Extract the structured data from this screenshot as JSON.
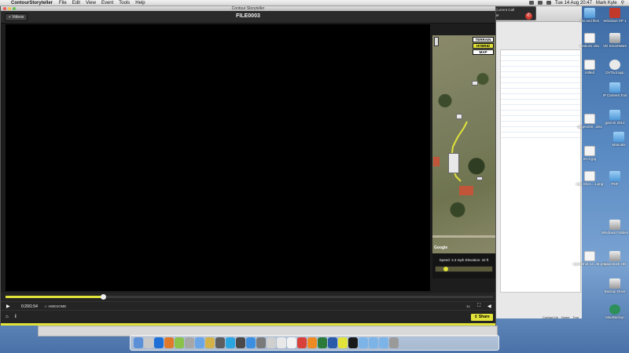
{
  "menubar": {
    "app_name": "ContourStoryteller",
    "menus": [
      "File",
      "Edit",
      "View",
      "Event",
      "Tools",
      "Help"
    ],
    "clock": "Tue 14 Aug 20:47",
    "user": "Mark Kyle"
  },
  "call_window": {
    "title": "Current Call",
    "caller": "elsyhller"
  },
  "app_window": {
    "title": "Contour Storyteller",
    "back_button": "« Videos",
    "file_title": "FILE0003",
    "map": {
      "types": [
        "TERRAIN",
        "HYBRID",
        "MAP"
      ],
      "selected_type": "HYBRID",
      "attribution": "Google",
      "telemetry": "Speed: 3.3 mph    Elevation: 32 ft",
      "slider_fraction": 0.18
    },
    "player": {
      "progress_fraction": 0.2,
      "timecode": "0:20/1:54",
      "awesome_label": "AWESOME",
      "speed_label": "1x",
      "share_label": "Share"
    }
  },
  "background_browser": {
    "footer_links": [
      "Contact Us",
      "Home",
      "Tour"
    ]
  },
  "desktop_icons": [
    "Windows XP 1",
    "rks and files",
    "VD SmartWare",
    "ntations xlsx",
    "DVTool.app",
    "ntitled",
    "IP Camera Tool",
    "garmin 2012",
    "adges200 ..xlsx",
    "Manuals",
    "ee-2.jpg",
    "een Shot ...1.png",
    "PDF",
    "Windows Folders",
    "reen Shot 12...M.png",
    "Macintosh HD",
    "Backup Drive",
    "MacBackup"
  ],
  "colors": {
    "accent": "#e1e23a",
    "player_bg": "#242424",
    "video_bg": "#000000",
    "desktop": "#5c8cc4"
  }
}
